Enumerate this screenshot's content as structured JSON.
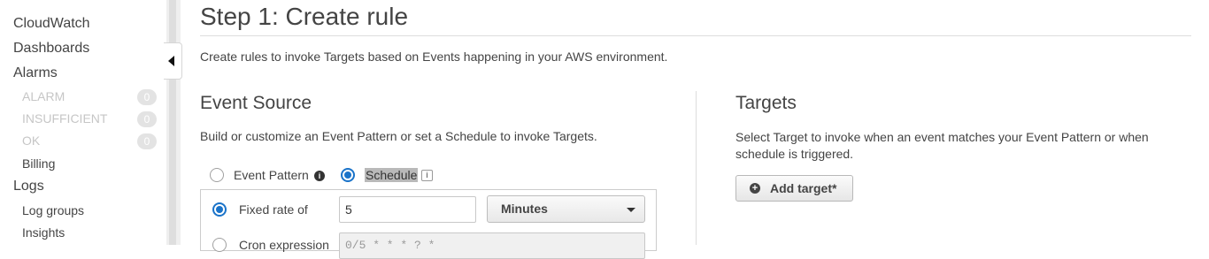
{
  "sidebar": {
    "items": [
      {
        "label": "CloudWatch"
      },
      {
        "label": "Dashboards"
      },
      {
        "label": "Alarms"
      },
      {
        "label": "ALARM",
        "count": "0"
      },
      {
        "label": "INSUFFICIENT",
        "count": "0"
      },
      {
        "label": "OK",
        "count": "0"
      },
      {
        "label": "Billing"
      },
      {
        "label": "Logs"
      },
      {
        "label": "Log groups"
      },
      {
        "label": "Insights"
      }
    ]
  },
  "page": {
    "title": "Step 1: Create rule",
    "description": "Create rules to invoke Targets based on Events happening in your AWS environment."
  },
  "event_source": {
    "heading": "Event Source",
    "description": "Build or customize an Event Pattern or set a Schedule to invoke Targets.",
    "options": {
      "event_pattern": "Event Pattern",
      "schedule": "Schedule"
    },
    "fixed_rate_label": "Fixed rate of",
    "fixed_rate_value": "5",
    "unit": "Minutes",
    "cron_label": "Cron expression",
    "cron_placeholder": "0/5 * * * ? *"
  },
  "targets": {
    "heading": "Targets",
    "description": "Select Target to invoke when an event matches your Event Pattern or when schedule is triggered.",
    "add_button": "Add target*"
  },
  "icons": {
    "info": "info-icon",
    "collapse": "caret-left-icon",
    "add": "plus-circle-icon"
  }
}
